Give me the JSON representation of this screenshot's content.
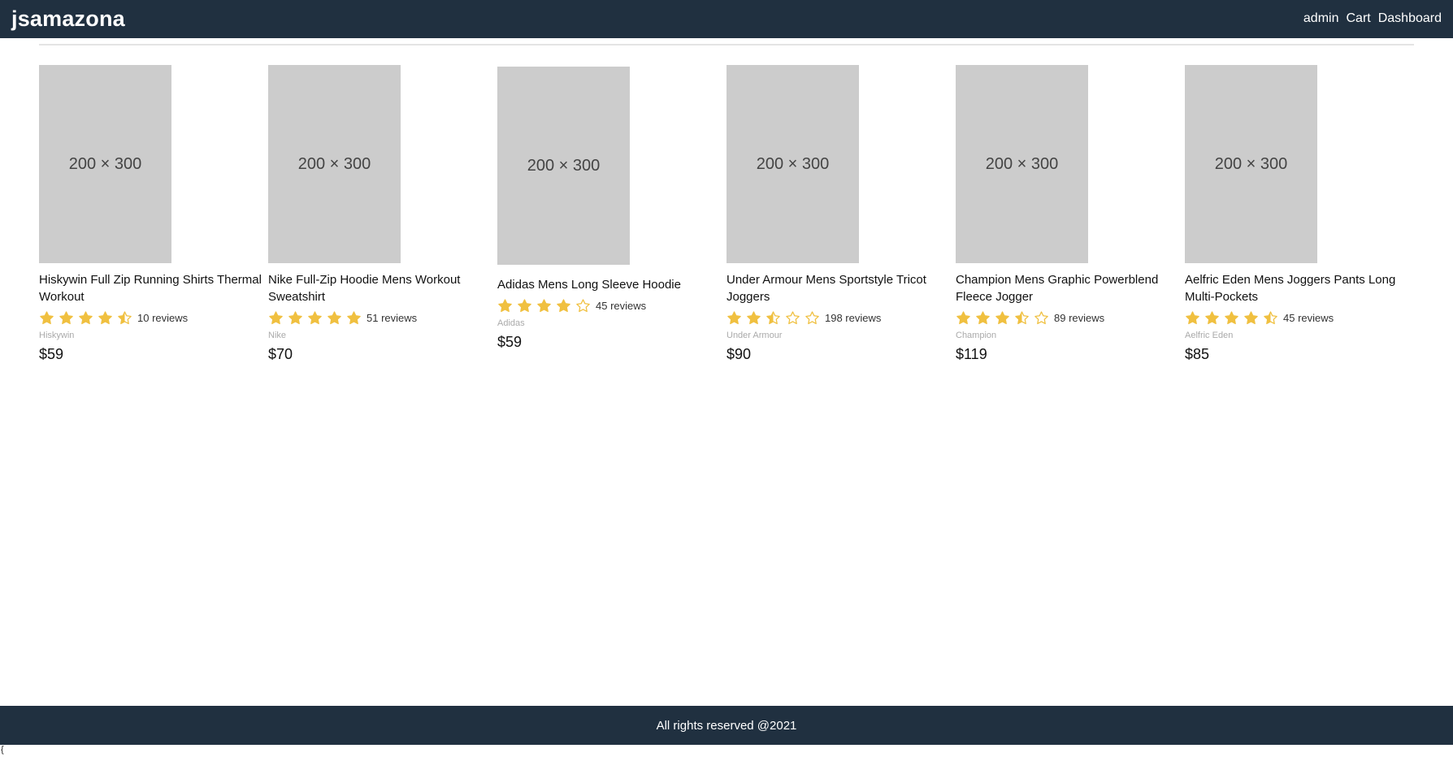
{
  "header": {
    "brand": "jsamazona",
    "nav": [
      "admin",
      "Cart",
      "Dashboard"
    ]
  },
  "colors": {
    "header_bg": "#203040",
    "star": "#f0c040",
    "placeholder": "#cccccc"
  },
  "products": [
    {
      "image_text": "200 × 300",
      "name": "Hiskywin Full Zip Running Shirts Thermal Workout",
      "rating": 4.5,
      "reviews": "10 reviews",
      "brand": "Hiskywin",
      "price": "$59"
    },
    {
      "image_text": "200 × 300",
      "name": "Nike Full-Zip Hoodie Mens Workout Sweatshirt",
      "rating": 5,
      "reviews": "51 reviews",
      "brand": "Nike",
      "price": "$70"
    },
    {
      "image_text": "200 × 300",
      "name": "Adidas Mens Long Sleeve Hoodie",
      "rating": 4,
      "reviews": "45 reviews",
      "brand": "Adidas",
      "price": "$59"
    },
    {
      "image_text": "200 × 300",
      "name": "Under Armour Mens Sportstyle Tricot Joggers",
      "rating": 2.5,
      "reviews": "198 reviews",
      "brand": "Under Armour",
      "price": "$90"
    },
    {
      "image_text": "200 × 300",
      "name": "Champion Mens Graphic Powerblend Fleece Jogger",
      "rating": 3.5,
      "reviews": "89 reviews",
      "brand": "Champion",
      "price": "$119"
    },
    {
      "image_text": "200 × 300",
      "name": "Aelfric Eden Mens Joggers Pants Long Multi-Pockets",
      "rating": 4.5,
      "reviews": "45 reviews",
      "brand": "Aelfric Eden",
      "price": "$85"
    }
  ],
  "footer": {
    "text": "All rights reserved @2021"
  },
  "stray_text": "{"
}
